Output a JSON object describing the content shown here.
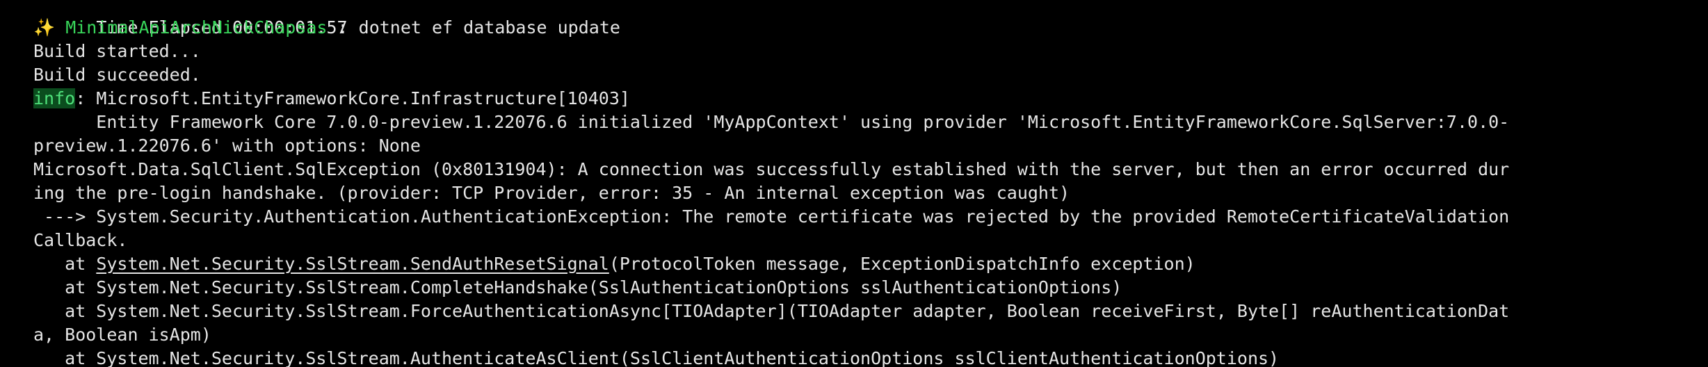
{
  "terminal": {
    "lines": [
      {
        "text": "Time Elapsed 00:00:01.57"
      },
      {
        "sparkle": "✨",
        "project": "MinimalApiArchNickChapsas",
        "command": " : dotnet ef database update"
      },
      {
        "text": "Build started..."
      },
      {
        "text": "Build succeeded."
      },
      {
        "tag": "info",
        "text": ": Microsoft.EntityFrameworkCore.Infrastructure[10403]"
      },
      {
        "text": "      Entity Framework Core 7.0.0-preview.1.22076.6 initialized 'MyAppContext' using provider 'Microsoft.EntityFrameworkCore.SqlServer:7.0.0-"
      },
      {
        "text": "preview.1.22076.6' with options: None"
      },
      {
        "text": "Microsoft.Data.SqlClient.SqlException (0x80131904): A connection was successfully established with the server, but then an error occurred dur"
      },
      {
        "text": "ing the pre-login handshake. (provider: TCP Provider, error: 35 - An internal exception was caught)"
      },
      {
        "text": " ---> System.Security.Authentication.AuthenticationException: The remote certificate was rejected by the provided RemoteCertificateValidation"
      },
      {
        "text": "Callback."
      },
      {
        "prefix": "   at ",
        "link": "System.Net.Security.SslStream.SendAuthResetSignal",
        "suffix": "(ProtocolToken message, ExceptionDispatchInfo exception)"
      },
      {
        "text": "   at System.Net.Security.SslStream.CompleteHandshake(SslAuthenticationOptions sslAuthenticationOptions)"
      },
      {
        "text": "   at System.Net.Security.SslStream.ForceAuthenticationAsync[TIOAdapter](TIOAdapter adapter, Boolean receiveFirst, Byte[] reAuthenticationDat"
      },
      {
        "text": "a, Boolean isApm)"
      },
      {
        "text": "   at System.Net.Security.SslStream.AuthenticateAsClient(SslClientAuthenticationOptions sslClientAuthenticationOptions)"
      }
    ]
  },
  "colors": {
    "background": "#000000",
    "foreground": "#e5e5e5",
    "project": "#38d65a",
    "info_bg": "#0b4d1e",
    "info_fg": "#4ee07a",
    "sparkle": "#e8d44d"
  }
}
